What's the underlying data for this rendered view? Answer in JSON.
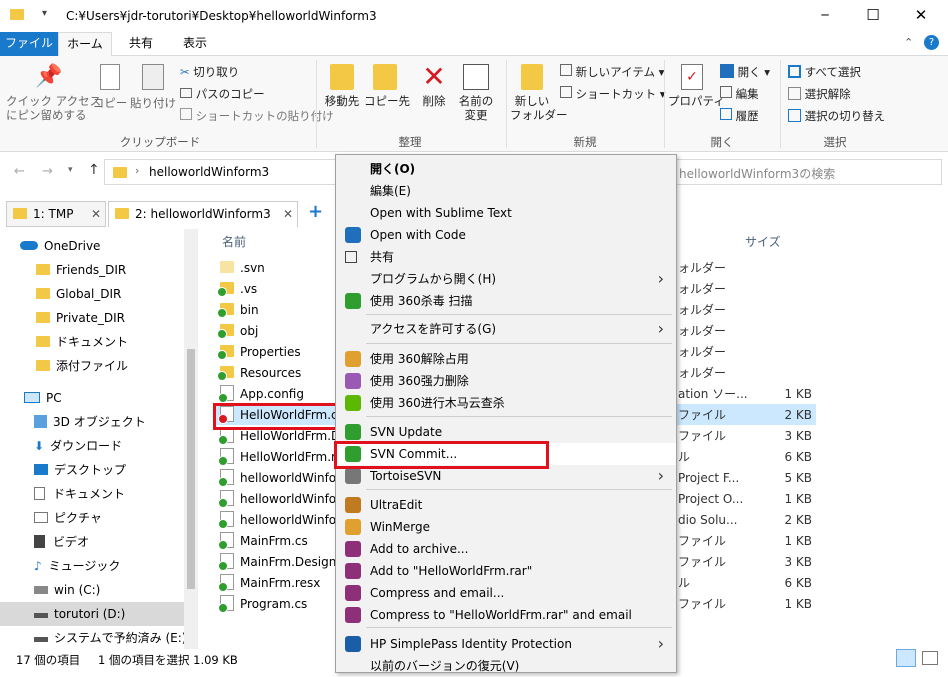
{
  "title": {
    "path": "C:¥Users¥jdr-torutori¥Desktop¥helloworldWinform3",
    "minimize": "─",
    "maximize": "☐",
    "close": "✕"
  },
  "ribbon_tabs": [
    "ファイル",
    "ホーム",
    "共有",
    "表示"
  ],
  "ribbon": {
    "pin": "クイック アクセス\nにピン留めする",
    "copy": "コピー",
    "paste": "貼り付け",
    "cut": "切り取り",
    "copy_path": "パスのコピー",
    "paste_shortcut": "ショートカットの貼り付け",
    "group_clipboard": "クリップボード",
    "move_to": "移動先",
    "copy_to": "コピー先",
    "delete": "削除",
    "rename": "名前の\n変更",
    "group_organize": "整理",
    "new_folder": "新しい\nフォルダー",
    "new_item": "新しいアイテム",
    "shortcut": "ショートカット",
    "group_new": "新規",
    "properties": "プロパティ",
    "open": "開く",
    "edit": "編集",
    "history": "履歴",
    "group_open": "開く",
    "select_all": "すべて選択",
    "select_none": "選択解除",
    "invert": "選択の切り替え",
    "group_select": "選択"
  },
  "address": {
    "path": "helloworldWinform3",
    "search": "helloworldWinform3の検索"
  },
  "folder_tabs": [
    {
      "num": "1:",
      "label": "TMP"
    },
    {
      "num": "2:",
      "label": "helloworldWinform3"
    }
  ],
  "nav": {
    "onedrive": "OneDrive",
    "od_items": [
      "Friends_DIR",
      "Global_DIR",
      "Private_DIR",
      "ドキュメント",
      "添付ファイル"
    ],
    "pc": "PC",
    "pc_items": [
      "3D オブジェクト",
      "ダウンロード",
      "デスクトップ",
      "ドキュメント",
      "ピクチャ",
      "ビデオ",
      "ミュージック",
      "win (C:)",
      "torutori (D:)",
      "システムで予約済み (E:)"
    ]
  },
  "columns": {
    "name": "名前",
    "size": "サイズ"
  },
  "files": [
    ".svn",
    ".vs",
    "bin",
    "obj",
    "Properties",
    "Resources",
    "App.config",
    "HelloWorldFrm.cs",
    "HelloWorldFrm.De",
    "HelloWorldFrm.re",
    "helloworldWinfor",
    "helloworldWinfor",
    "helloworldWinfor",
    "MainFrm.cs",
    "MainFrm.Designer",
    "MainFrm.resx",
    "Program.cs"
  ],
  "right_col": [
    {
      "type": "ォルダー",
      "size": ""
    },
    {
      "type": "ォルダー",
      "size": ""
    },
    {
      "type": "ォルダー",
      "size": ""
    },
    {
      "type": "ォルダー",
      "size": ""
    },
    {
      "type": "ォルダー",
      "size": ""
    },
    {
      "type": "ォルダー",
      "size": ""
    },
    {
      "type": "ation ソー...",
      "size": "1 KB"
    },
    {
      "type": "ファイル",
      "size": "2 KB"
    },
    {
      "type": "ファイル",
      "size": "3 KB"
    },
    {
      "type": "ル",
      "size": "6 KB"
    },
    {
      "type": "Project F...",
      "size": "5 KB"
    },
    {
      "type": "Project O...",
      "size": "1 KB"
    },
    {
      "type": "dio Solu...",
      "size": "2 KB"
    },
    {
      "type": "ファイル",
      "size": "1 KB"
    },
    {
      "type": "ファイル",
      "size": "3 KB"
    },
    {
      "type": "ル",
      "size": "6 KB"
    },
    {
      "type": "ファイル",
      "size": "1 KB"
    }
  ],
  "status": {
    "count": "17 個の項目",
    "selected": "1 個の項目を選択  1.09 KB"
  },
  "menu": [
    {
      "label": "開く(O)",
      "bold": true
    },
    {
      "label": "編集(E)"
    },
    {
      "label": "Open with Sublime Text"
    },
    {
      "label": "Open with Code"
    },
    {
      "label": "共有"
    },
    {
      "label": "プログラムから開く(H)",
      "sub": true
    },
    {
      "label": "使用 360杀毒 扫描"
    },
    {
      "label": "アクセスを許可する(G)",
      "sub": true
    },
    {
      "label": "使用 360解除占用"
    },
    {
      "label": "使用 360强力删除"
    },
    {
      "label": "使用 360进行木马云查杀"
    },
    {
      "label": "SVN Update"
    },
    {
      "label": "SVN Commit..."
    },
    {
      "label": "TortoiseSVN",
      "sub": true
    },
    {
      "label": "UltraEdit"
    },
    {
      "label": "WinMerge"
    },
    {
      "label": "Add to archive..."
    },
    {
      "label": "Add to \"HelloWorldFrm.rar\""
    },
    {
      "label": "Compress and email..."
    },
    {
      "label": "Compress to \"HelloWorldFrm.rar\" and email"
    },
    {
      "label": "HP SimplePass Identity Protection",
      "sub": true
    },
    {
      "label": "以前のバージョンの復元(V)"
    }
  ],
  "colors": {
    "accent": "#1979ca",
    "highlight": "#cce8ff",
    "red": "#e0101c"
  }
}
